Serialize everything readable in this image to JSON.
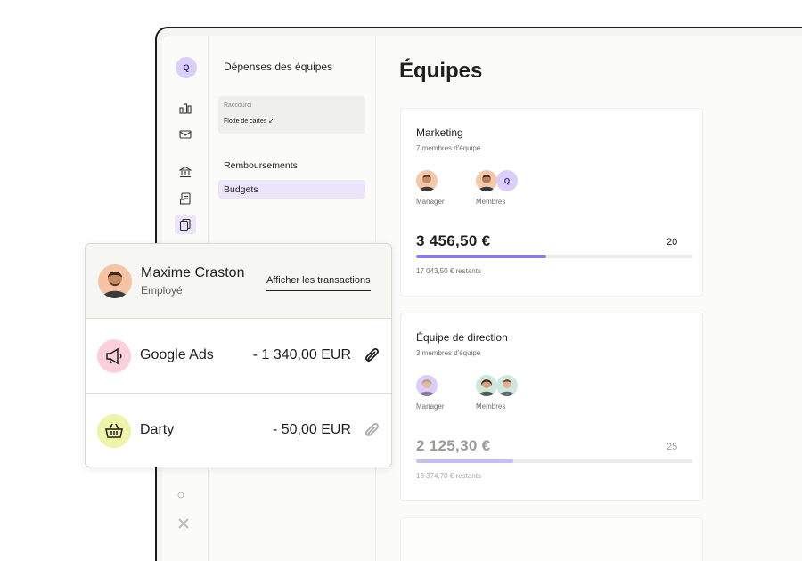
{
  "rail": {
    "avatar_initial": "Q",
    "icons": [
      "bar-chart-icon",
      "inbox-icon",
      "bank-icon",
      "receipt-icon",
      "cards-icon"
    ]
  },
  "subnav": {
    "title": "Dépenses des équipes",
    "shortcut_label": "Raccourci",
    "shortcut_link": "Flotte de cartes ↙",
    "items": [
      {
        "label": "Remboursements",
        "active": false
      },
      {
        "label": "Budgets",
        "active": true
      }
    ]
  },
  "main": {
    "title": "Équipes",
    "teams": [
      {
        "name": "Marketing",
        "members": "7 membres d'équipe",
        "manager_label": "Manager",
        "members_label": "Membres",
        "member_extra_initial": "Q",
        "amount": "3 456,50 €",
        "total": "20",
        "progress": 0.47,
        "remaining": "17 043,50 € restants"
      },
      {
        "name": "Équipe de direction",
        "members": "3 membres d'équipe",
        "manager_label": "Manager",
        "members_label": "Membres",
        "amount": "2 125,30 €",
        "total": "25",
        "progress": 0.35,
        "remaining": "18 374,70 € restants"
      }
    ]
  },
  "popup": {
    "user_name": "Maxime Craston",
    "user_role": "Employé",
    "link": "Afficher les transactions",
    "transactions": [
      {
        "merchant": "Google Ads",
        "amount": "- 1 340,00 EUR",
        "icon": "megaphone-icon",
        "color": "#fbd0dc"
      },
      {
        "merchant": "Darty",
        "amount": "- 50,00 EUR",
        "icon": "basket-icon",
        "color": "#eef4a8"
      }
    ]
  },
  "colors": {
    "accent": "#8f79ea",
    "accent_light": "#ebe5fb"
  }
}
